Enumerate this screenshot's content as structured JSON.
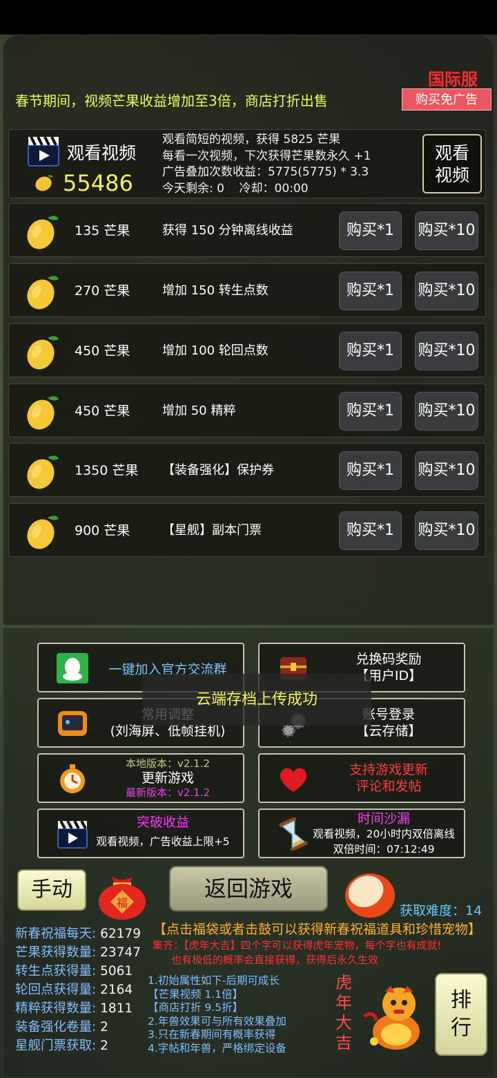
{
  "header": {
    "server_tag": "国际服",
    "no_ads_button": "购买免广告",
    "notice": "春节期间，视频芒果收益增加至3倍，商店打折出售"
  },
  "video": {
    "title": "观看视频",
    "mango_count": "55486",
    "desc_lines": [
      "观看简短的视频，获得 5825 芒果",
      "每看一次视频，下次获得芒果数永久 +1",
      "广告叠加次数收益：5775(5775) * 3.3",
      "今天剩余: 0    冷却：00:00"
    ],
    "watch_button_line1": "观看",
    "watch_button_line2": "视频"
  },
  "shop": {
    "buy1_label": "购买*1",
    "buy10_label": "购买*10",
    "items": [
      {
        "price": "135 芒果",
        "desc": "获得 150 分钟离线收益"
      },
      {
        "price": "270 芒果",
        "desc": "增加 150 转生点数"
      },
      {
        "price": "450 芒果",
        "desc": "增加 100 轮回点数"
      },
      {
        "price": "450 芒果",
        "desc": "增加 50 精粹"
      },
      {
        "price": "1350 芒果",
        "desc": "【装备强化】保护券"
      },
      {
        "price": "900 芒果",
        "desc": "【星舰】副本门票"
      }
    ]
  },
  "options": {
    "join_group": "一键加入官方交流群",
    "redeem_line1": "兑换码奖励",
    "redeem_line2": "【用户ID】",
    "common_settings_line1": "常用调整",
    "common_settings_line2": "(刘海屏、低帧挂机)",
    "account_line1": "账号登录",
    "account_line2": "【云存储】",
    "local_version": "本地版本：v2.1.2",
    "update_game": "更新游戏",
    "latest_version": "最新版本：v2.1.2",
    "support_line1": "支持游戏更新",
    "support_line2": "评论和发帖",
    "breakthrough_title": "突破收益",
    "breakthrough_desc": "观看视频，广告收益上限+5",
    "hourglass_title": "时间沙漏",
    "hourglass_desc": "观看视频，20小时内双倍离线",
    "double_time": "双倍时间：07:12:49"
  },
  "toast": "云端存档上传成功",
  "bottom": {
    "manual": "手动",
    "fu": "福",
    "return_game": "返回游戏",
    "difficulty": "获取难度：14",
    "festival_tip": "【点击福袋或者击鼓可以获得新春祝福道具和珍惜宠物】",
    "rule1": "集齐：【虎年大吉】四个字可以获得虎年宠物，每个字也有成就!",
    "rule2": "也有极低的概率会直接获得，获得后永久生效",
    "stats": [
      {
        "label": "新春祝福每天:",
        "value": "62179"
      },
      {
        "label": "芒果获得数量:",
        "value": "23747"
      },
      {
        "label": "转生点获得量:",
        "value": "5061"
      },
      {
        "label": "轮回点获得量:",
        "value": "2164"
      },
      {
        "label": "精粹获得数量:",
        "value": "1811"
      },
      {
        "label": "装备强化卷量:",
        "value": "2"
      },
      {
        "label": "星舰门票获取:",
        "value": "2"
      }
    ],
    "notes": [
      "1.初始属性如下-后期可成长",
      "【芒果视频 1.1倍】",
      "【商店打折 9.5折】",
      "2.年兽效果可与所有效果叠加",
      "3.只在新春期间有概率获得",
      "4.字帖和年兽，严格绑定设备"
    ],
    "huyear": [
      "虎",
      "年",
      "大",
      "吉"
    ],
    "rank_line1": "排",
    "rank_line2": "行"
  },
  "colors": {
    "accent_yellow": "#f4f25a",
    "notice_yellow": "#e8ff5a",
    "red": "#ff2a2a",
    "stat_blue": "#7fbfff"
  },
  "icons": [
    "clapperboard-icon",
    "mango-icon",
    "qq-penguin-icon",
    "treasure-chest-icon",
    "tablet-device-icon",
    "gear-icon",
    "stopwatch-icon",
    "heart-icon",
    "hourglass-icon",
    "lucky-bag-icon",
    "drum-icon",
    "tiger-mascot-icon"
  ]
}
